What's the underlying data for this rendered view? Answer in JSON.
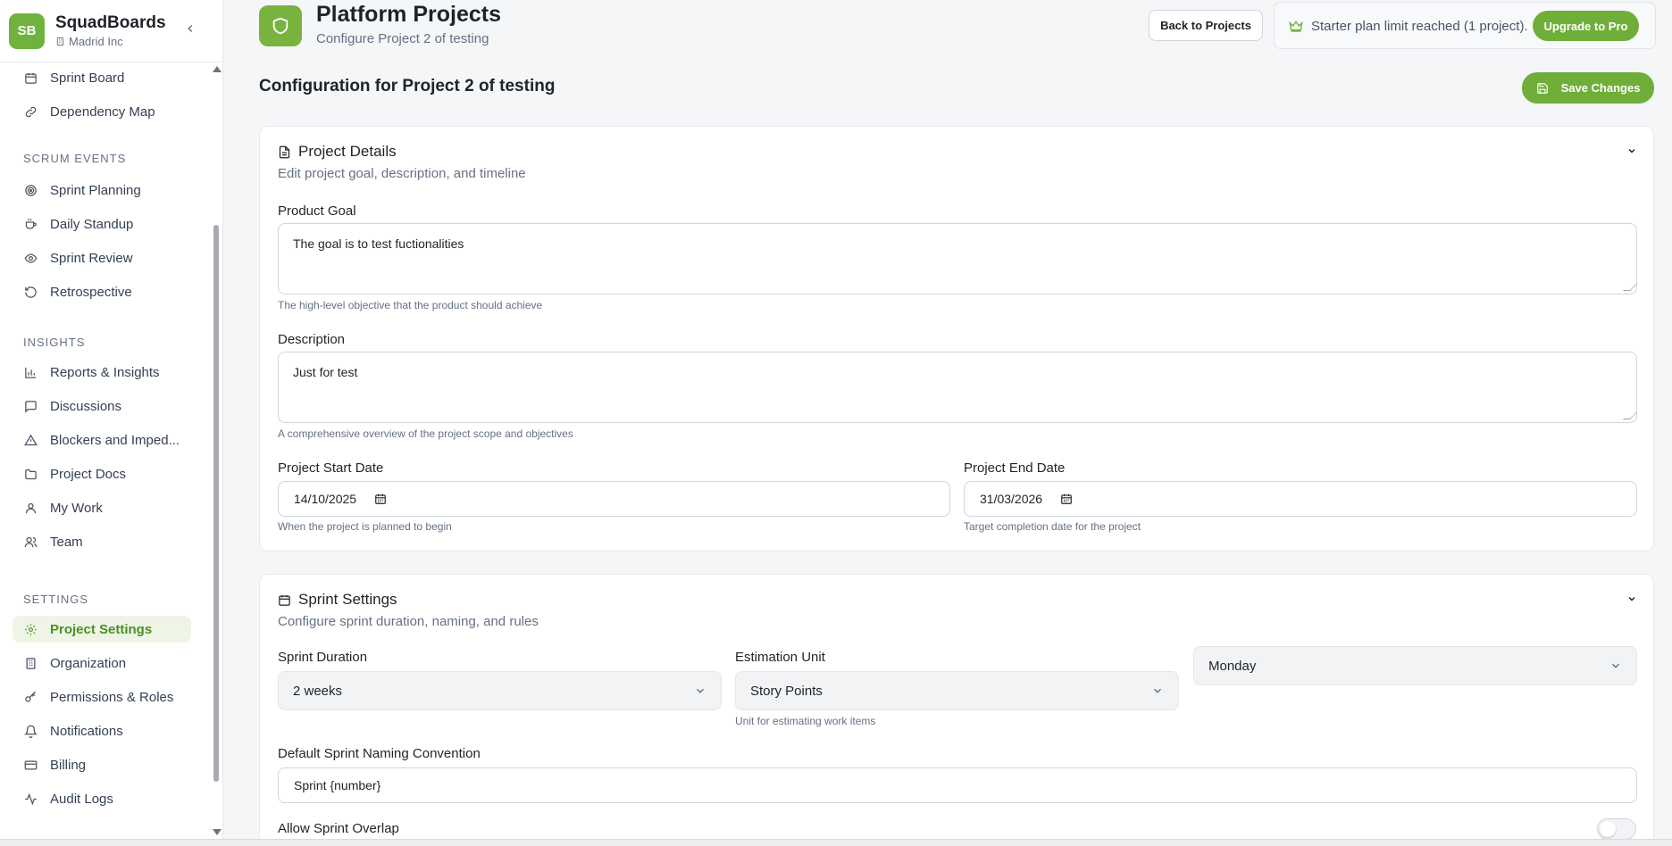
{
  "brand": {
    "initials": "SB",
    "name": "SquadBoards",
    "org": "Madrid Inc"
  },
  "sidebar": {
    "top_items": [
      {
        "label": "Sprint Board",
        "icon": "calendar-icon"
      },
      {
        "label": "Dependency Map",
        "icon": "link-icon"
      }
    ],
    "sections": [
      {
        "title": "SCRUM EVENTS",
        "items": [
          {
            "label": "Sprint Planning",
            "icon": "target-icon"
          },
          {
            "label": "Daily Standup",
            "icon": "coffee-icon"
          },
          {
            "label": "Sprint Review",
            "icon": "eye-icon"
          },
          {
            "label": "Retrospective",
            "icon": "rotate-ccw-icon"
          }
        ]
      },
      {
        "title": "INSIGHTS",
        "items": [
          {
            "label": "Reports & Insights",
            "icon": "bar-chart-icon"
          },
          {
            "label": "Discussions",
            "icon": "message-square-icon"
          },
          {
            "label": "Blockers and Imped...",
            "icon": "alert-triangle-icon"
          },
          {
            "label": "Project Docs",
            "icon": "folder-icon"
          },
          {
            "label": "My Work",
            "icon": "user-icon"
          },
          {
            "label": "Team",
            "icon": "users-icon"
          }
        ]
      },
      {
        "title": "SETTINGS",
        "items": [
          {
            "label": "Project Settings",
            "icon": "gear-icon",
            "active": true
          },
          {
            "label": "Organization",
            "icon": "building-icon"
          },
          {
            "label": "Permissions & Roles",
            "icon": "key-icon"
          },
          {
            "label": "Notifications",
            "icon": "bell-icon"
          },
          {
            "label": "Billing",
            "icon": "credit-card-icon"
          },
          {
            "label": "Audit Logs",
            "icon": "activity-icon"
          }
        ]
      }
    ]
  },
  "header": {
    "title": "Platform Projects",
    "subtitle": "Configure Project 2 of testing",
    "back_label": "Back to Projects",
    "plan_notice": "Starter plan limit reached (1 project).",
    "upgrade_label": "Upgrade to Pro"
  },
  "config": {
    "title": "Configuration for Project 2 of testing",
    "save_label": "Save Changes"
  },
  "project_details": {
    "title": "Project Details",
    "description": "Edit project goal, description, and timeline",
    "product_goal_label": "Product Goal",
    "product_goal_value": "The goal is to test fuctionalities",
    "product_goal_hint": "The high-level objective that the product should achieve",
    "description_label": "Description",
    "description_value": "Just for test",
    "description_hint": "A comprehensive overview of the project scope and objectives",
    "start_label": "Project Start Date",
    "start_value": "14/10/2025",
    "start_hint": "When the project is planned to begin",
    "end_label": "Project End Date",
    "end_value": "31/03/2026",
    "end_hint": "Target completion date for the project"
  },
  "sprint_settings": {
    "title": "Sprint Settings",
    "description": "Configure sprint duration, naming, and rules",
    "duration_label": "Sprint Duration",
    "duration_value": "2 weeks",
    "estimation_label": "Estimation Unit",
    "estimation_value": "Story Points",
    "estimation_hint": "Unit for estimating work items",
    "start_day_value": "Monday",
    "naming_label": "Default Sprint Naming Convention",
    "naming_value": "Sprint {number}",
    "overlap_label": "Allow Sprint Overlap",
    "overlap_enabled": false
  },
  "colors": {
    "accent": "#6fae38",
    "active_bg": "#eef5e6",
    "active_text": "#4f8f24"
  }
}
